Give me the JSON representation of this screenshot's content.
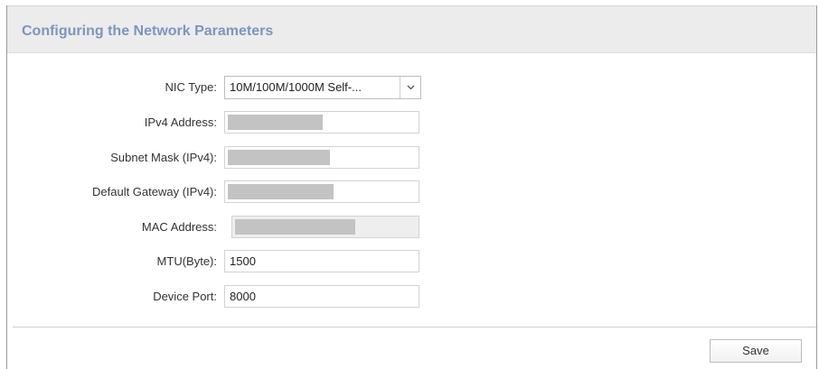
{
  "header": {
    "title": "Configuring the Network Parameters"
  },
  "form": {
    "nic_type": {
      "label": "NIC Type:",
      "value": "10M/100M/1000M Self-...",
      "icon": "chevron-down-icon"
    },
    "ipv4_address": {
      "label": "IPv4 Address:",
      "value": ""
    },
    "subnet_mask": {
      "label": "Subnet Mask (IPv4):",
      "value": ""
    },
    "default_gateway": {
      "label": "Default Gateway (IPv4):",
      "value": ""
    },
    "mac_address": {
      "label": "MAC Address:",
      "value": ""
    },
    "mtu": {
      "label": "MTU(Byte):",
      "value": "1500"
    },
    "device_port": {
      "label": "Device Port:",
      "value": "8000"
    }
  },
  "actions": {
    "save_label": "Save"
  },
  "colors": {
    "title": "#7c96bd",
    "header_bg": "#ececec",
    "redaction": "#c3c3c3"
  }
}
